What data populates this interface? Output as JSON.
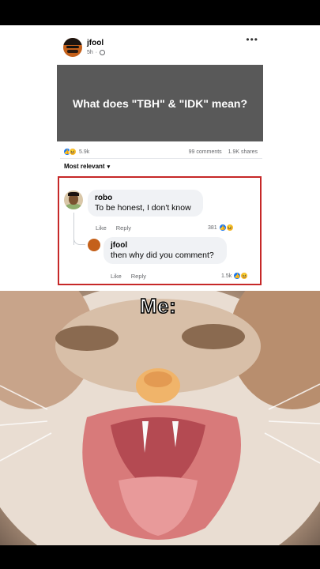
{
  "post": {
    "author": "jfool",
    "time": "5h",
    "more_icon": "more-horizontal-icon",
    "privacy_icon": "globe-icon",
    "banner_text": "What does \"TBH\" & \"IDK\" mean?",
    "banner_color": "#595959",
    "reaction_count": "5.9k",
    "comments": "99 comments",
    "shares": "1.9K shares",
    "sort_label": "Most relevant"
  },
  "comments": [
    {
      "name": "robo",
      "text": "To be honest, I don't know",
      "like": "Like",
      "reply": "Reply",
      "reactions": "381"
    },
    {
      "name": "jfool",
      "text": "then why did you comment?",
      "like": "Like",
      "reply": "Reply",
      "reactions": "1.5k"
    }
  ],
  "highlight_color": "#c62828",
  "meme": {
    "caption": "Me:"
  }
}
